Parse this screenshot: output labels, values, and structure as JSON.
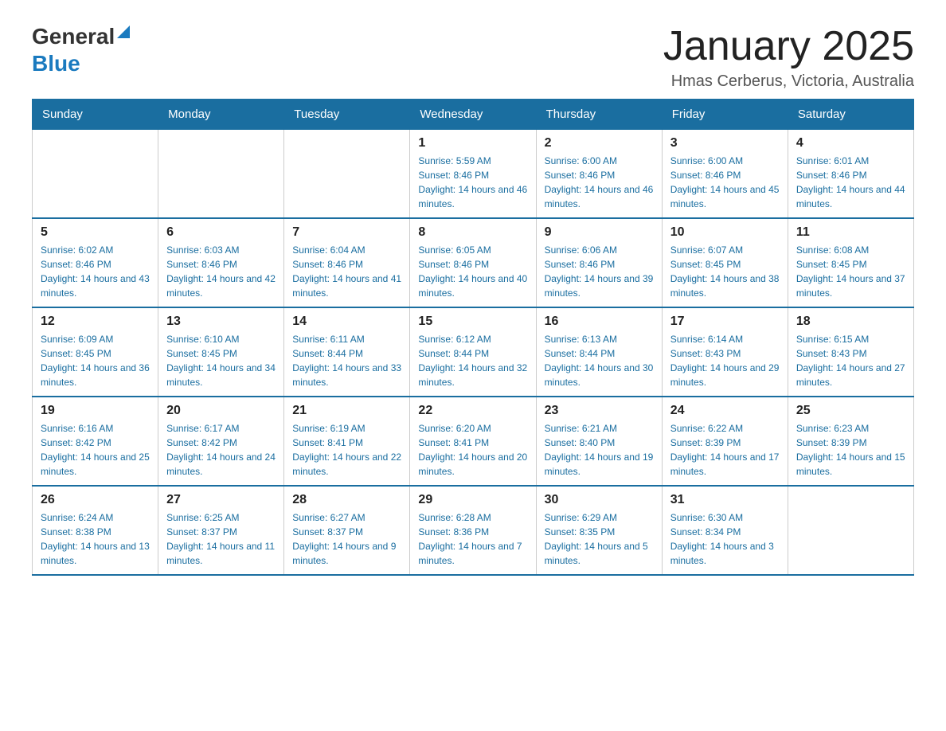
{
  "header": {
    "logo_general": "General",
    "logo_blue": "Blue",
    "main_title": "January 2025",
    "subtitle": "Hmas Cerberus, Victoria, Australia"
  },
  "calendar": {
    "days_of_week": [
      "Sunday",
      "Monday",
      "Tuesday",
      "Wednesday",
      "Thursday",
      "Friday",
      "Saturday"
    ],
    "weeks": [
      [
        {
          "day": "",
          "info": ""
        },
        {
          "day": "",
          "info": ""
        },
        {
          "day": "",
          "info": ""
        },
        {
          "day": "1",
          "info": "Sunrise: 5:59 AM\nSunset: 8:46 PM\nDaylight: 14 hours and 46 minutes."
        },
        {
          "day": "2",
          "info": "Sunrise: 6:00 AM\nSunset: 8:46 PM\nDaylight: 14 hours and 46 minutes."
        },
        {
          "day": "3",
          "info": "Sunrise: 6:00 AM\nSunset: 8:46 PM\nDaylight: 14 hours and 45 minutes."
        },
        {
          "day": "4",
          "info": "Sunrise: 6:01 AM\nSunset: 8:46 PM\nDaylight: 14 hours and 44 minutes."
        }
      ],
      [
        {
          "day": "5",
          "info": "Sunrise: 6:02 AM\nSunset: 8:46 PM\nDaylight: 14 hours and 43 minutes."
        },
        {
          "day": "6",
          "info": "Sunrise: 6:03 AM\nSunset: 8:46 PM\nDaylight: 14 hours and 42 minutes."
        },
        {
          "day": "7",
          "info": "Sunrise: 6:04 AM\nSunset: 8:46 PM\nDaylight: 14 hours and 41 minutes."
        },
        {
          "day": "8",
          "info": "Sunrise: 6:05 AM\nSunset: 8:46 PM\nDaylight: 14 hours and 40 minutes."
        },
        {
          "day": "9",
          "info": "Sunrise: 6:06 AM\nSunset: 8:46 PM\nDaylight: 14 hours and 39 minutes."
        },
        {
          "day": "10",
          "info": "Sunrise: 6:07 AM\nSunset: 8:45 PM\nDaylight: 14 hours and 38 minutes."
        },
        {
          "day": "11",
          "info": "Sunrise: 6:08 AM\nSunset: 8:45 PM\nDaylight: 14 hours and 37 minutes."
        }
      ],
      [
        {
          "day": "12",
          "info": "Sunrise: 6:09 AM\nSunset: 8:45 PM\nDaylight: 14 hours and 36 minutes."
        },
        {
          "day": "13",
          "info": "Sunrise: 6:10 AM\nSunset: 8:45 PM\nDaylight: 14 hours and 34 minutes."
        },
        {
          "day": "14",
          "info": "Sunrise: 6:11 AM\nSunset: 8:44 PM\nDaylight: 14 hours and 33 minutes."
        },
        {
          "day": "15",
          "info": "Sunrise: 6:12 AM\nSunset: 8:44 PM\nDaylight: 14 hours and 32 minutes."
        },
        {
          "day": "16",
          "info": "Sunrise: 6:13 AM\nSunset: 8:44 PM\nDaylight: 14 hours and 30 minutes."
        },
        {
          "day": "17",
          "info": "Sunrise: 6:14 AM\nSunset: 8:43 PM\nDaylight: 14 hours and 29 minutes."
        },
        {
          "day": "18",
          "info": "Sunrise: 6:15 AM\nSunset: 8:43 PM\nDaylight: 14 hours and 27 minutes."
        }
      ],
      [
        {
          "day": "19",
          "info": "Sunrise: 6:16 AM\nSunset: 8:42 PM\nDaylight: 14 hours and 25 minutes."
        },
        {
          "day": "20",
          "info": "Sunrise: 6:17 AM\nSunset: 8:42 PM\nDaylight: 14 hours and 24 minutes."
        },
        {
          "day": "21",
          "info": "Sunrise: 6:19 AM\nSunset: 8:41 PM\nDaylight: 14 hours and 22 minutes."
        },
        {
          "day": "22",
          "info": "Sunrise: 6:20 AM\nSunset: 8:41 PM\nDaylight: 14 hours and 20 minutes."
        },
        {
          "day": "23",
          "info": "Sunrise: 6:21 AM\nSunset: 8:40 PM\nDaylight: 14 hours and 19 minutes."
        },
        {
          "day": "24",
          "info": "Sunrise: 6:22 AM\nSunset: 8:39 PM\nDaylight: 14 hours and 17 minutes."
        },
        {
          "day": "25",
          "info": "Sunrise: 6:23 AM\nSunset: 8:39 PM\nDaylight: 14 hours and 15 minutes."
        }
      ],
      [
        {
          "day": "26",
          "info": "Sunrise: 6:24 AM\nSunset: 8:38 PM\nDaylight: 14 hours and 13 minutes."
        },
        {
          "day": "27",
          "info": "Sunrise: 6:25 AM\nSunset: 8:37 PM\nDaylight: 14 hours and 11 minutes."
        },
        {
          "day": "28",
          "info": "Sunrise: 6:27 AM\nSunset: 8:37 PM\nDaylight: 14 hours and 9 minutes."
        },
        {
          "day": "29",
          "info": "Sunrise: 6:28 AM\nSunset: 8:36 PM\nDaylight: 14 hours and 7 minutes."
        },
        {
          "day": "30",
          "info": "Sunrise: 6:29 AM\nSunset: 8:35 PM\nDaylight: 14 hours and 5 minutes."
        },
        {
          "day": "31",
          "info": "Sunrise: 6:30 AM\nSunset: 8:34 PM\nDaylight: 14 hours and 3 minutes."
        },
        {
          "day": "",
          "info": ""
        }
      ]
    ]
  }
}
